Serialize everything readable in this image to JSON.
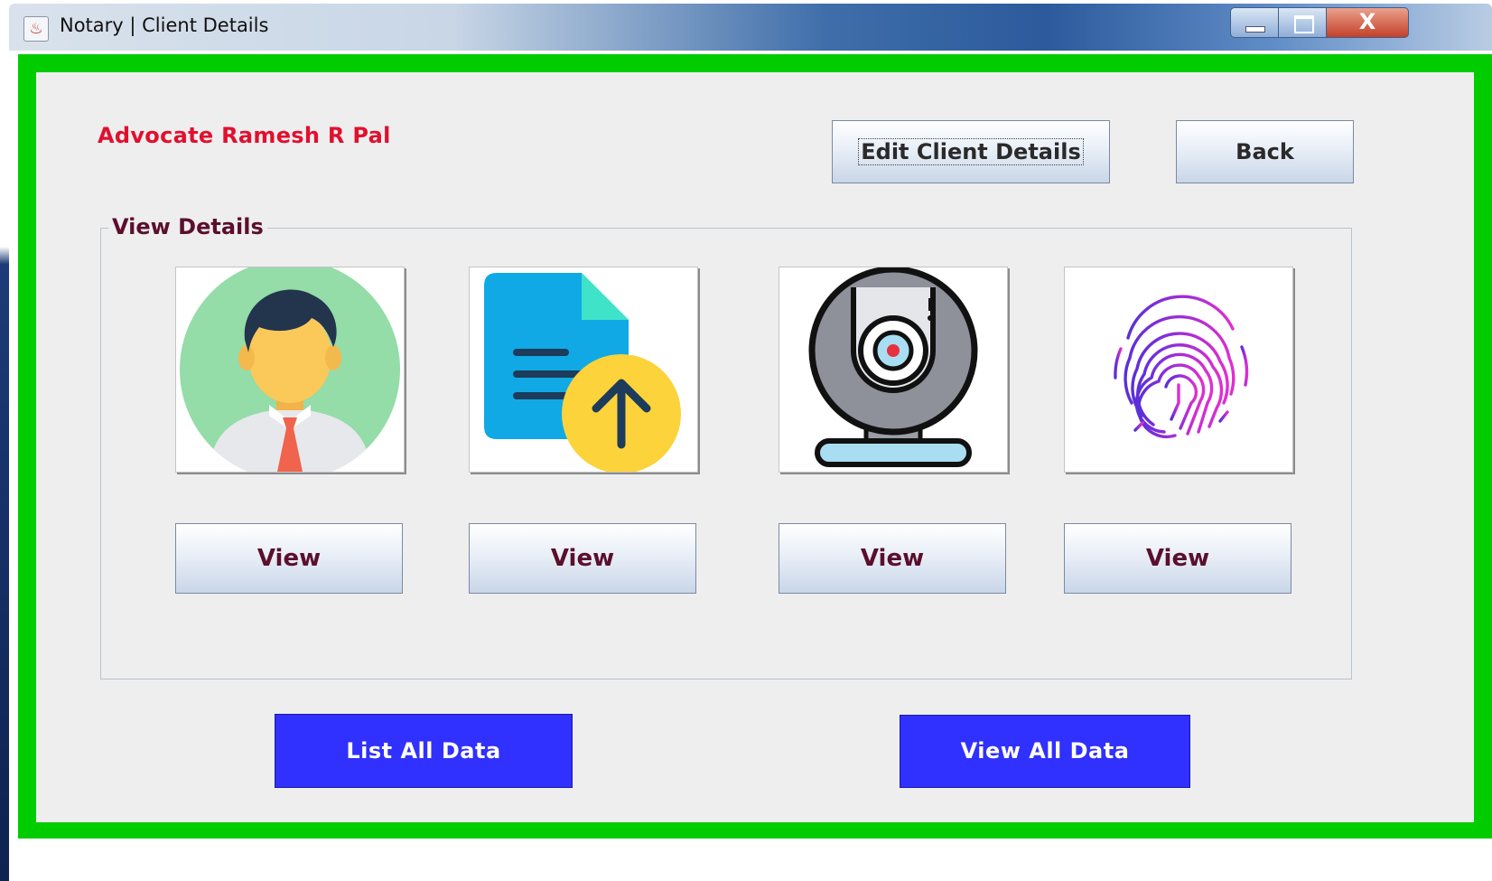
{
  "window": {
    "title": "Notary | Client Details",
    "close_glyph": "X",
    "app_icon": "java-cup-icon"
  },
  "header": {
    "advocate_name": "Advocate Ramesh R Pal",
    "edit_label": "Edit Client Details",
    "back_label": "Back"
  },
  "details": {
    "group_title": "View Details",
    "tiles": [
      {
        "icon": "user-avatar-icon",
        "button_label": "View"
      },
      {
        "icon": "document-upload-icon",
        "button_label": "View"
      },
      {
        "icon": "webcam-icon",
        "button_label": "View"
      },
      {
        "icon": "fingerprint-icon",
        "button_label": "View"
      }
    ]
  },
  "footer": {
    "list_all_label": "List All Data",
    "view_all_label": "View All Data"
  },
  "colors": {
    "frame": "#00cc00",
    "accent_blue": "#3030ff",
    "advocate_red": "#e0102e",
    "label_maroon": "#5b0f2c"
  }
}
